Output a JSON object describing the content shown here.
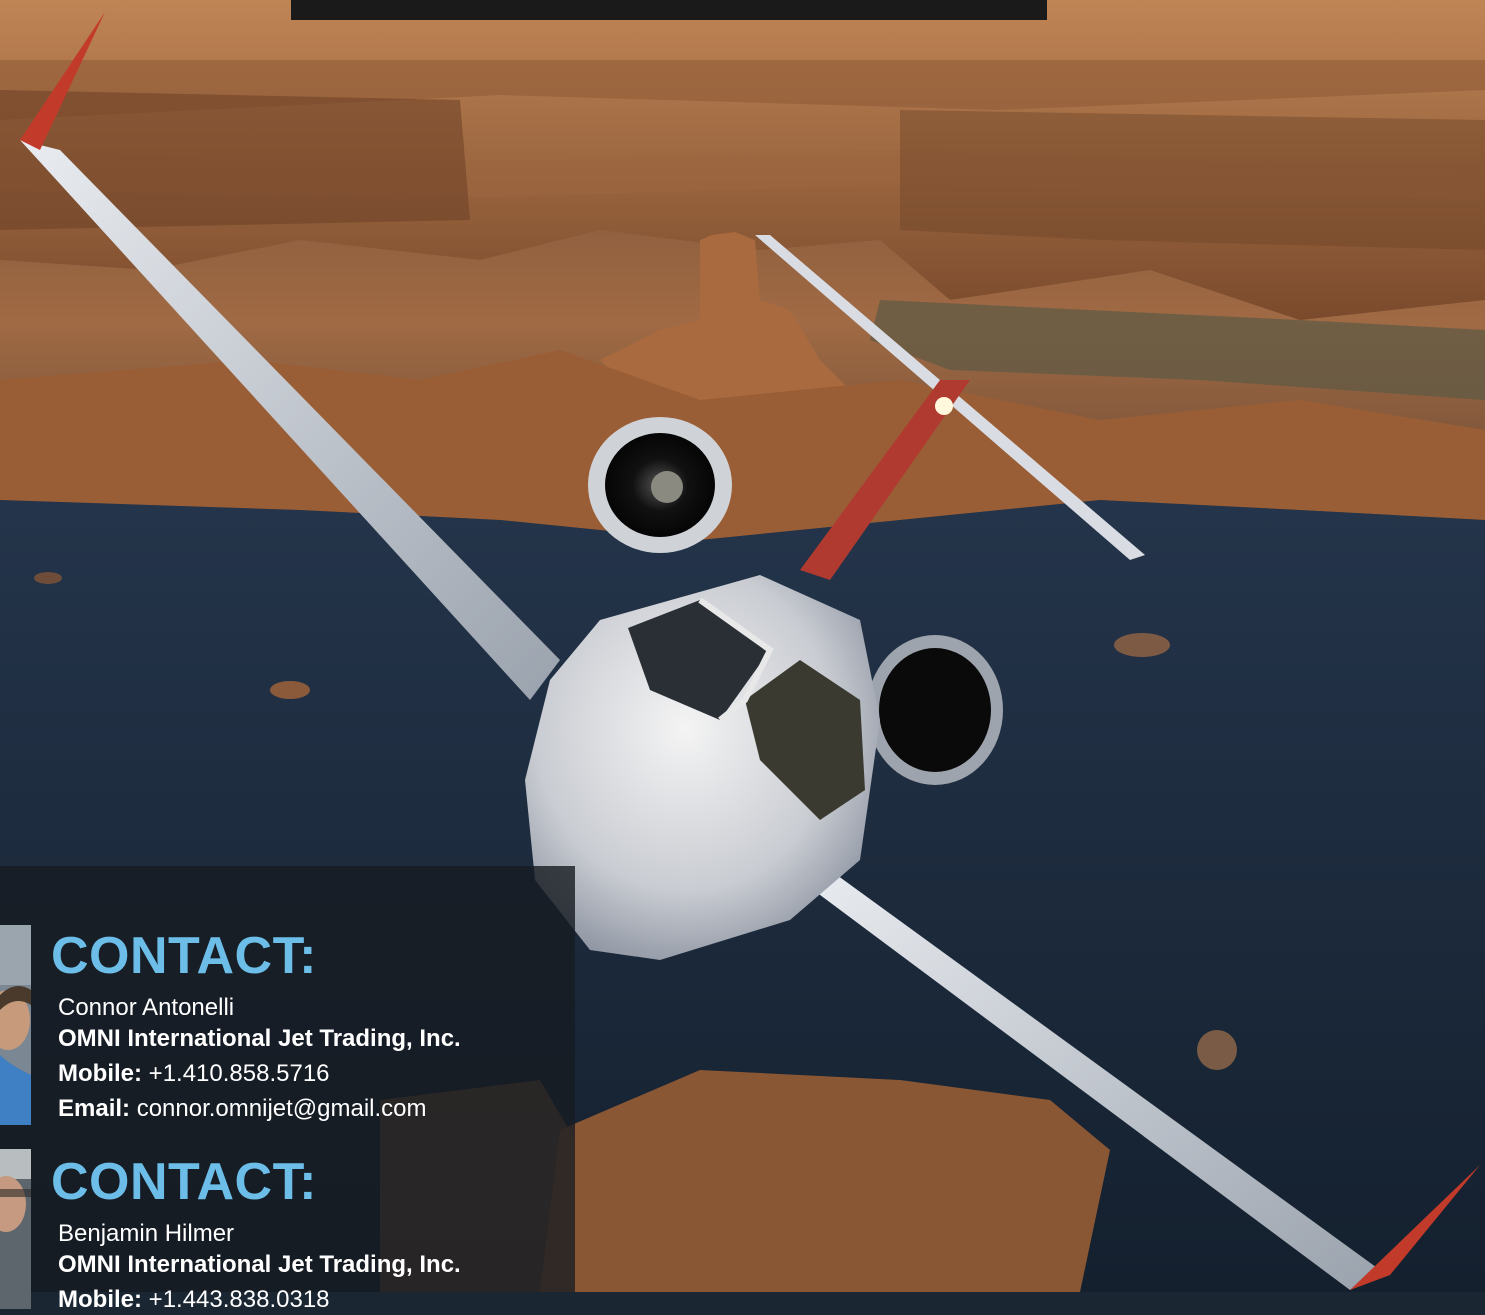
{
  "contacts": [
    {
      "title": "CONTACT:",
      "name": "Connor Antonelli",
      "company": "OMNI International Jet Trading, Inc.",
      "mobile_label": "Mobile:",
      "mobile": "+1.410.858.5716",
      "email_label": "Email:",
      "email": "connor.omnijet@gmail.com"
    },
    {
      "title": "CONTACT:",
      "name": "Benjamin Hilmer",
      "company": "OMNI International Jet Trading, Inc.",
      "mobile_label": "Mobile:",
      "mobile": "+1.443.838.0318"
    }
  ],
  "colors": {
    "accent": "#6cbde8",
    "panel": "#161c22",
    "water": "#1b2a3c",
    "rock": "#b8784a"
  },
  "icons": [
    "jet-aircraft-photo",
    "contact-photo"
  ]
}
